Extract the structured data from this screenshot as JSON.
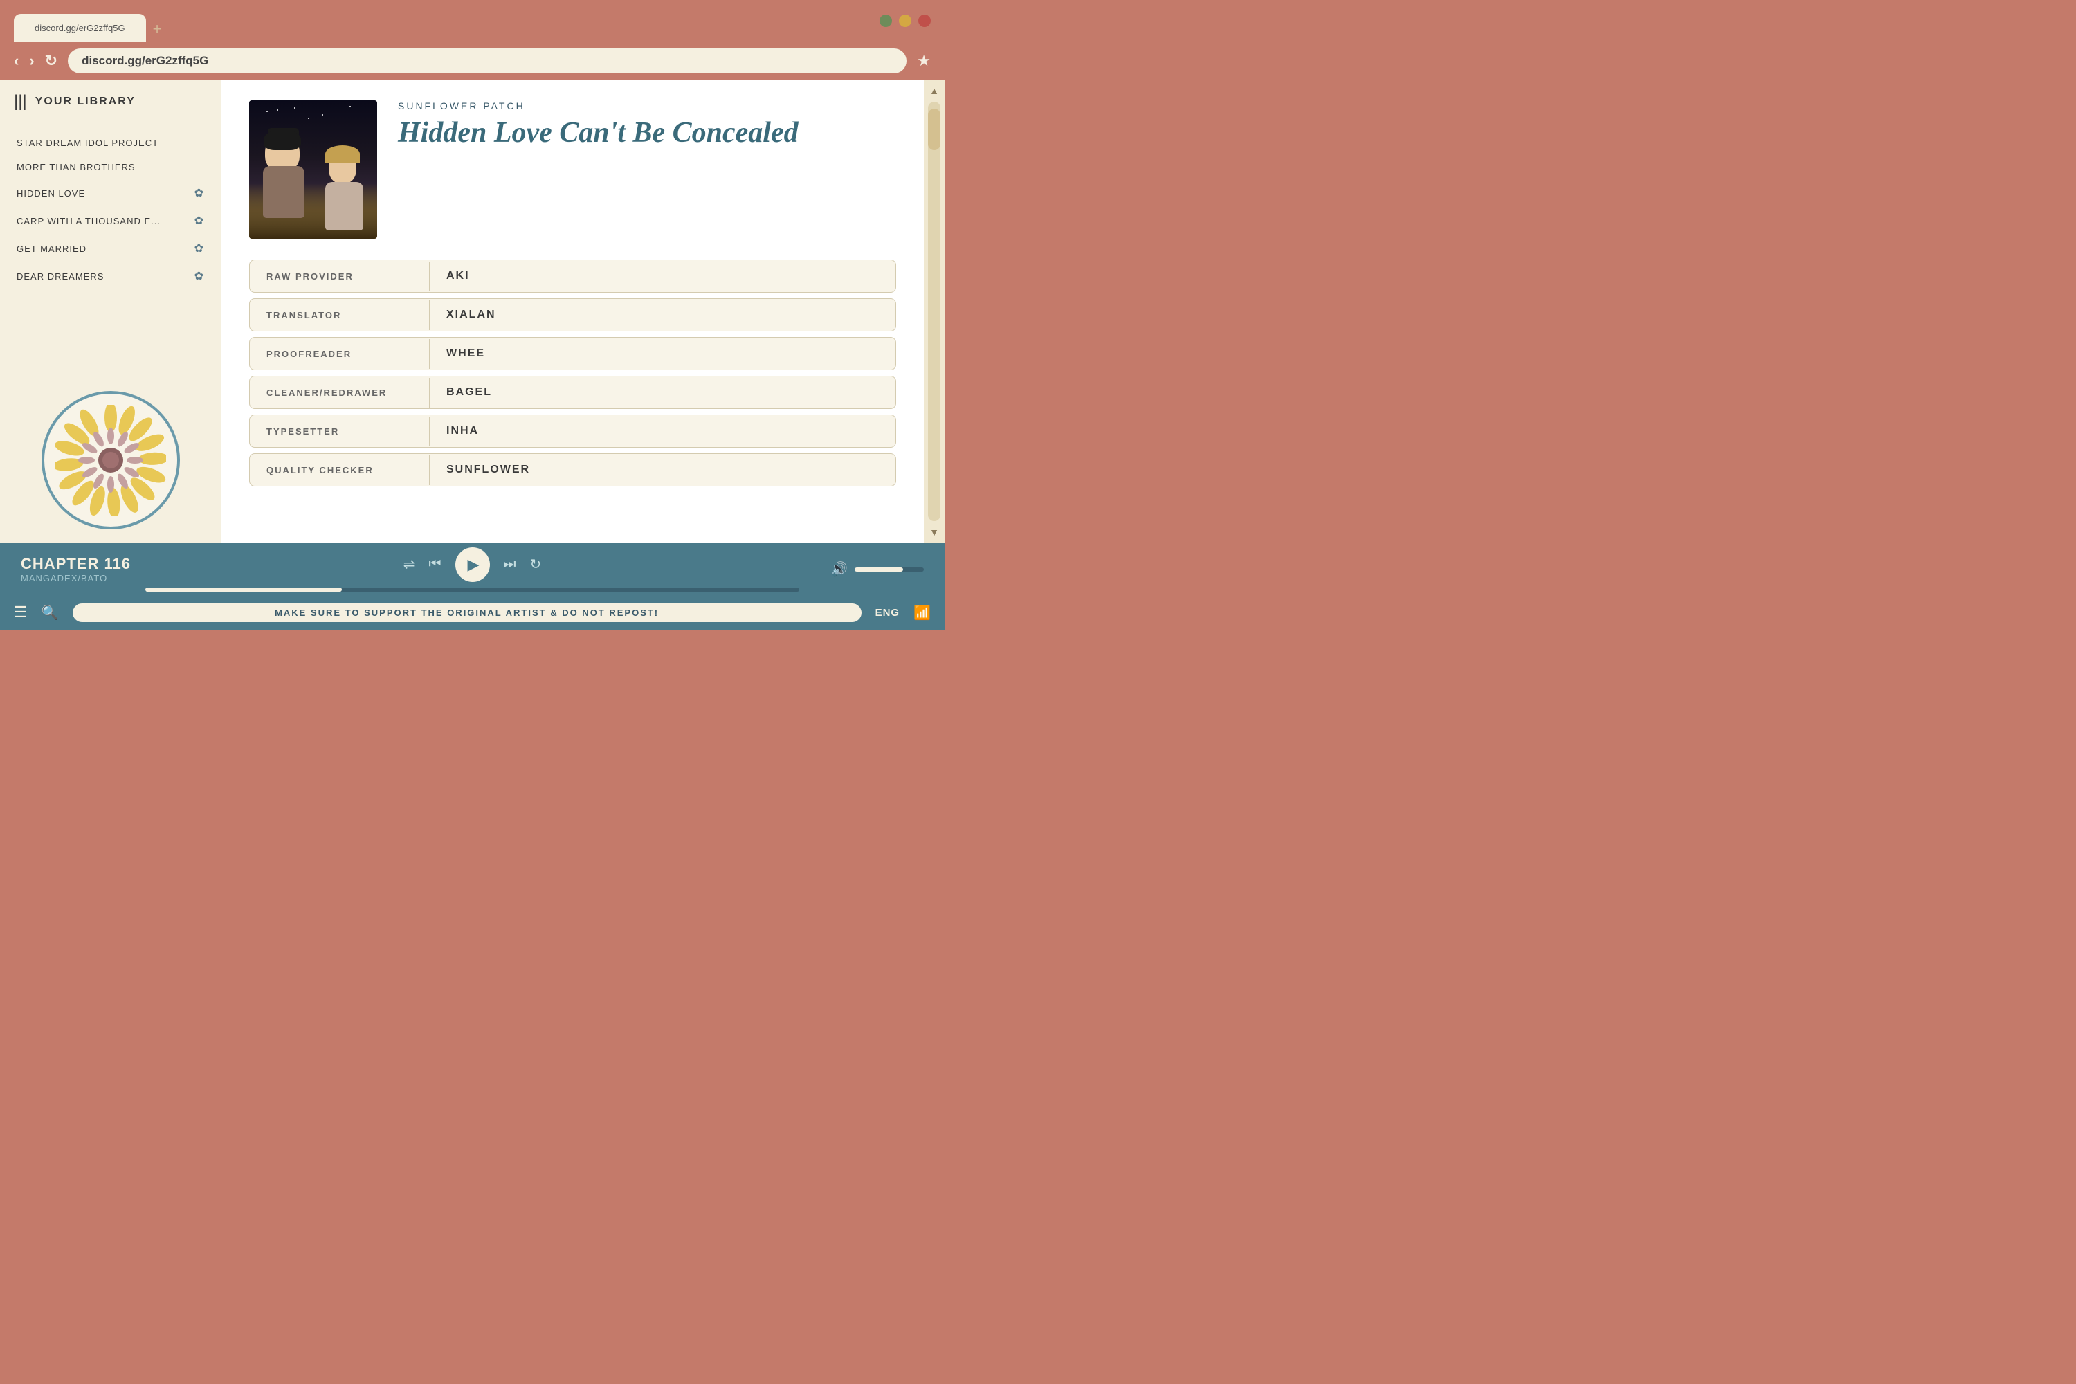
{
  "browser": {
    "tab_label": "discord.gg/erG2zffq5G",
    "url": "discord.gg/erG2zffq5G",
    "tab_new": "+",
    "nav": {
      "back": "‹",
      "forward": "›",
      "refresh": "↻",
      "star": "★"
    }
  },
  "sidebar": {
    "title": "YOUR LIBRARY",
    "items": [
      {
        "label": "STAR DREAM IDOL PROJECT",
        "has_icon": false
      },
      {
        "label": "MORE THAN BROTHERS",
        "has_icon": false
      },
      {
        "label": "HIDDEN LOVE",
        "has_icon": true
      },
      {
        "label": "CARP WITH A THOUSAND E...",
        "has_icon": true
      },
      {
        "label": "GET MARRIED",
        "has_icon": true
      },
      {
        "label": "DEAR DREAMERS",
        "has_icon": true
      }
    ]
  },
  "manga": {
    "publisher": "SUNFLOWER PATCH",
    "title": "Hidden Love Can't Be Concealed",
    "credits": [
      {
        "label": "RAW PROVIDER",
        "value": "AKI"
      },
      {
        "label": "TRANSLATOR",
        "value": "XIALAN"
      },
      {
        "label": "PROOFREADER",
        "value": "WHEE"
      },
      {
        "label": "CLEANER/REDRAWER",
        "value": "BAGEL"
      },
      {
        "label": "TYPESETTER",
        "value": "INHA"
      },
      {
        "label": "QUALITY CHECKER",
        "value": "SUNFLOWER"
      }
    ]
  },
  "player": {
    "chapter": "CHAPTER 116",
    "source": "MANGADEX/BATO",
    "controls": {
      "shuffle": "⇌",
      "prev": "⏮",
      "play": "▶",
      "next": "⏭",
      "repeat": "↻"
    },
    "volume_icon": "🔊"
  },
  "bottom_bar": {
    "announcement": "MAKE SURE TO SUPPORT THE ORIGINAL ARTIST & DO NOT REPOST!",
    "language": "ENG"
  },
  "window_controls": {
    "green": "#6e8c5a",
    "yellow": "#d4a843",
    "red": "#c0504a"
  }
}
